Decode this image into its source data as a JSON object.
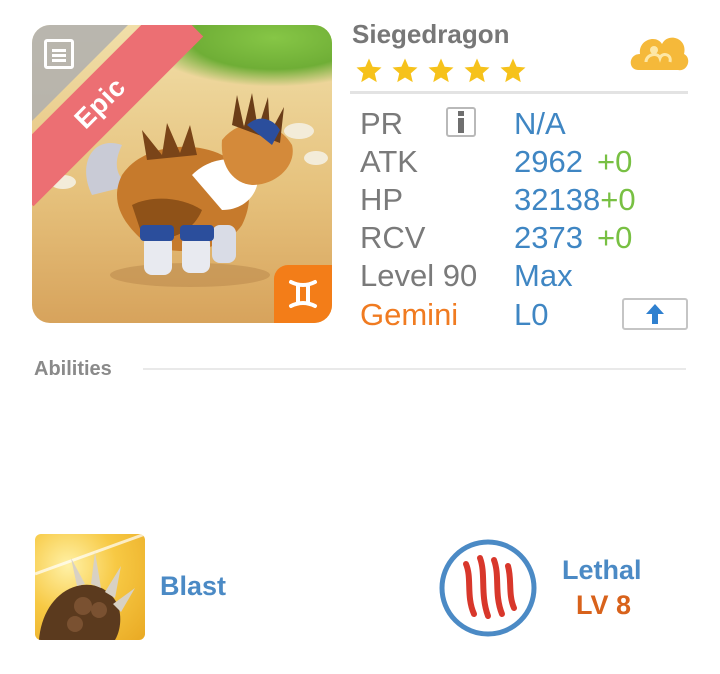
{
  "monster": {
    "name": "Siegedragon",
    "stars": 5,
    "rarity": "Epic",
    "sign_icon": "gemini-icon"
  },
  "stats": {
    "pr": {
      "label": "PR",
      "value": "N/A"
    },
    "atk": {
      "label": "ATK",
      "value": "2962",
      "bonus": "+0"
    },
    "hp": {
      "label": "HP",
      "value": "32138",
      "bonus": "+0"
    },
    "rcv": {
      "label": "RCV",
      "value": "2373",
      "bonus": "+0"
    },
    "level": {
      "label": "Level 90",
      "value": "Max"
    },
    "sign": {
      "label": "Gemini",
      "value": "L0"
    }
  },
  "abilities": {
    "title": "Abilities",
    "skill": {
      "name": "Blast",
      "icon": "claw-icon"
    },
    "passive": {
      "name": "Lethal",
      "level": "LV 8",
      "icon": "scratch-icon"
    }
  },
  "colors": {
    "value_blue": "#3f86c3",
    "bonus_green": "#78c043",
    "gemini_orange": "#f07b21",
    "star_yellow": "#f6c21b",
    "ribbon_red": "#ec6f73"
  }
}
